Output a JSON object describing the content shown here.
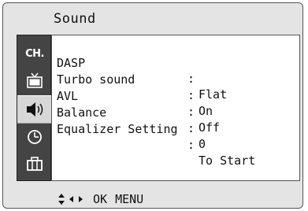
{
  "title": "Sound",
  "sidebar": {
    "items": [
      {
        "name": "channel",
        "label": "CH."
      },
      {
        "name": "tv-picture",
        "icon": "tv-icon"
      },
      {
        "name": "sound",
        "icon": "speaker-icon",
        "selected": true
      },
      {
        "name": "time",
        "icon": "clock-icon"
      },
      {
        "name": "setup",
        "icon": "toolbox-icon"
      }
    ]
  },
  "menu": {
    "rows": [
      {
        "label": "DASP",
        "colon": ":",
        "value": "Flat"
      },
      {
        "label": "Turbo sound",
        "colon": ":",
        "value": "On"
      },
      {
        "label": "AVL",
        "colon": ":",
        "value": "Off"
      },
      {
        "label": "Balance",
        "colon": ":",
        "value": "0"
      },
      {
        "label": "Equalizer Setting",
        "colon": ":",
        "value": "To Start"
      }
    ]
  },
  "footer": {
    "ok_label": "OK",
    "menu_label": "MENU"
  }
}
